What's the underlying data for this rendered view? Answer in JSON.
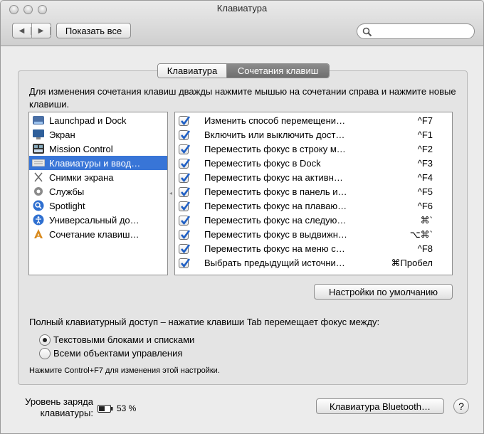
{
  "window": {
    "title": "Клавиатура"
  },
  "toolbar": {
    "back_icon": "◀",
    "forward_icon": "▶",
    "show_all": "Показать все",
    "search_placeholder": ""
  },
  "tabs": [
    {
      "label": "Клавиатура",
      "active": false
    },
    {
      "label": "Сочетания клавиш",
      "active": true
    }
  ],
  "description": "Для изменения сочетания клавиш дважды нажмите мышью на сочетании справа и нажмите новые клавиши.",
  "categories": [
    {
      "label": "Launchpad и Dock",
      "icon": "launchpad-icon",
      "selected": false
    },
    {
      "label": "Экран",
      "icon": "display-icon",
      "selected": false
    },
    {
      "label": "Mission Control",
      "icon": "mission-control-icon",
      "selected": false
    },
    {
      "label": "Клавиатуры и ввод…",
      "icon": "keyboard-icon",
      "selected": true
    },
    {
      "label": "Снимки экрана",
      "icon": "screenshot-icon",
      "selected": false
    },
    {
      "label": "Службы",
      "icon": "gear-icon",
      "selected": false
    },
    {
      "label": "Spotlight",
      "icon": "spotlight-icon",
      "selected": false
    },
    {
      "label": "Универсальный до…",
      "icon": "accessibility-icon",
      "selected": false
    },
    {
      "label": "Сочетание клавиш…",
      "icon": "app-shortcuts-icon",
      "selected": false
    }
  ],
  "shortcuts": [
    {
      "action": "Изменить способ перемещени…",
      "key": "^F7",
      "checked": true
    },
    {
      "action": "Включить или выключить дост…",
      "key": "^F1",
      "checked": true
    },
    {
      "action": "Переместить фокус в строку м…",
      "key": "^F2",
      "checked": true
    },
    {
      "action": "Переместить фокус в Dock",
      "key": "^F3",
      "checked": true
    },
    {
      "action": "Переместить фокус на активн…",
      "key": "^F4",
      "checked": true
    },
    {
      "action": "Переместить фокус в панель и…",
      "key": "^F5",
      "checked": true
    },
    {
      "action": "Переместить фокус на плаваю…",
      "key": "^F6",
      "checked": true
    },
    {
      "action": "Переместить фокус на следую…",
      "key": "⌘`",
      "checked": true
    },
    {
      "action": "Переместить фокус в выдвижн…",
      "key": "⌥⌘`",
      "checked": true
    },
    {
      "action": "Переместить фокус на меню с…",
      "key": "^F8",
      "checked": true
    },
    {
      "action": "Выбрать предыдущий источни…",
      "key": "⌘Пробел",
      "checked": true
    }
  ],
  "defaults_button": "Настройки по умолчанию",
  "full_access": {
    "label": "Полный клавиатурный доступ – нажатие клавиши Tab перемещает фокус между:",
    "options": [
      {
        "label": "Текстовыми блоками и списками",
        "selected": true
      },
      {
        "label": "Всеми объектами управления",
        "selected": false
      }
    ],
    "hint": "Нажмите Control+F7 для изменения этой настройки."
  },
  "battery": {
    "label": "Уровень заряда клавиатуры:",
    "percent": "53 %",
    "level": 0.53
  },
  "bluetooth_button": "Клавиатура Bluetooth…",
  "help_label": "?",
  "colors": {
    "selection": "#3875d7",
    "check": "#1f5fc4"
  }
}
